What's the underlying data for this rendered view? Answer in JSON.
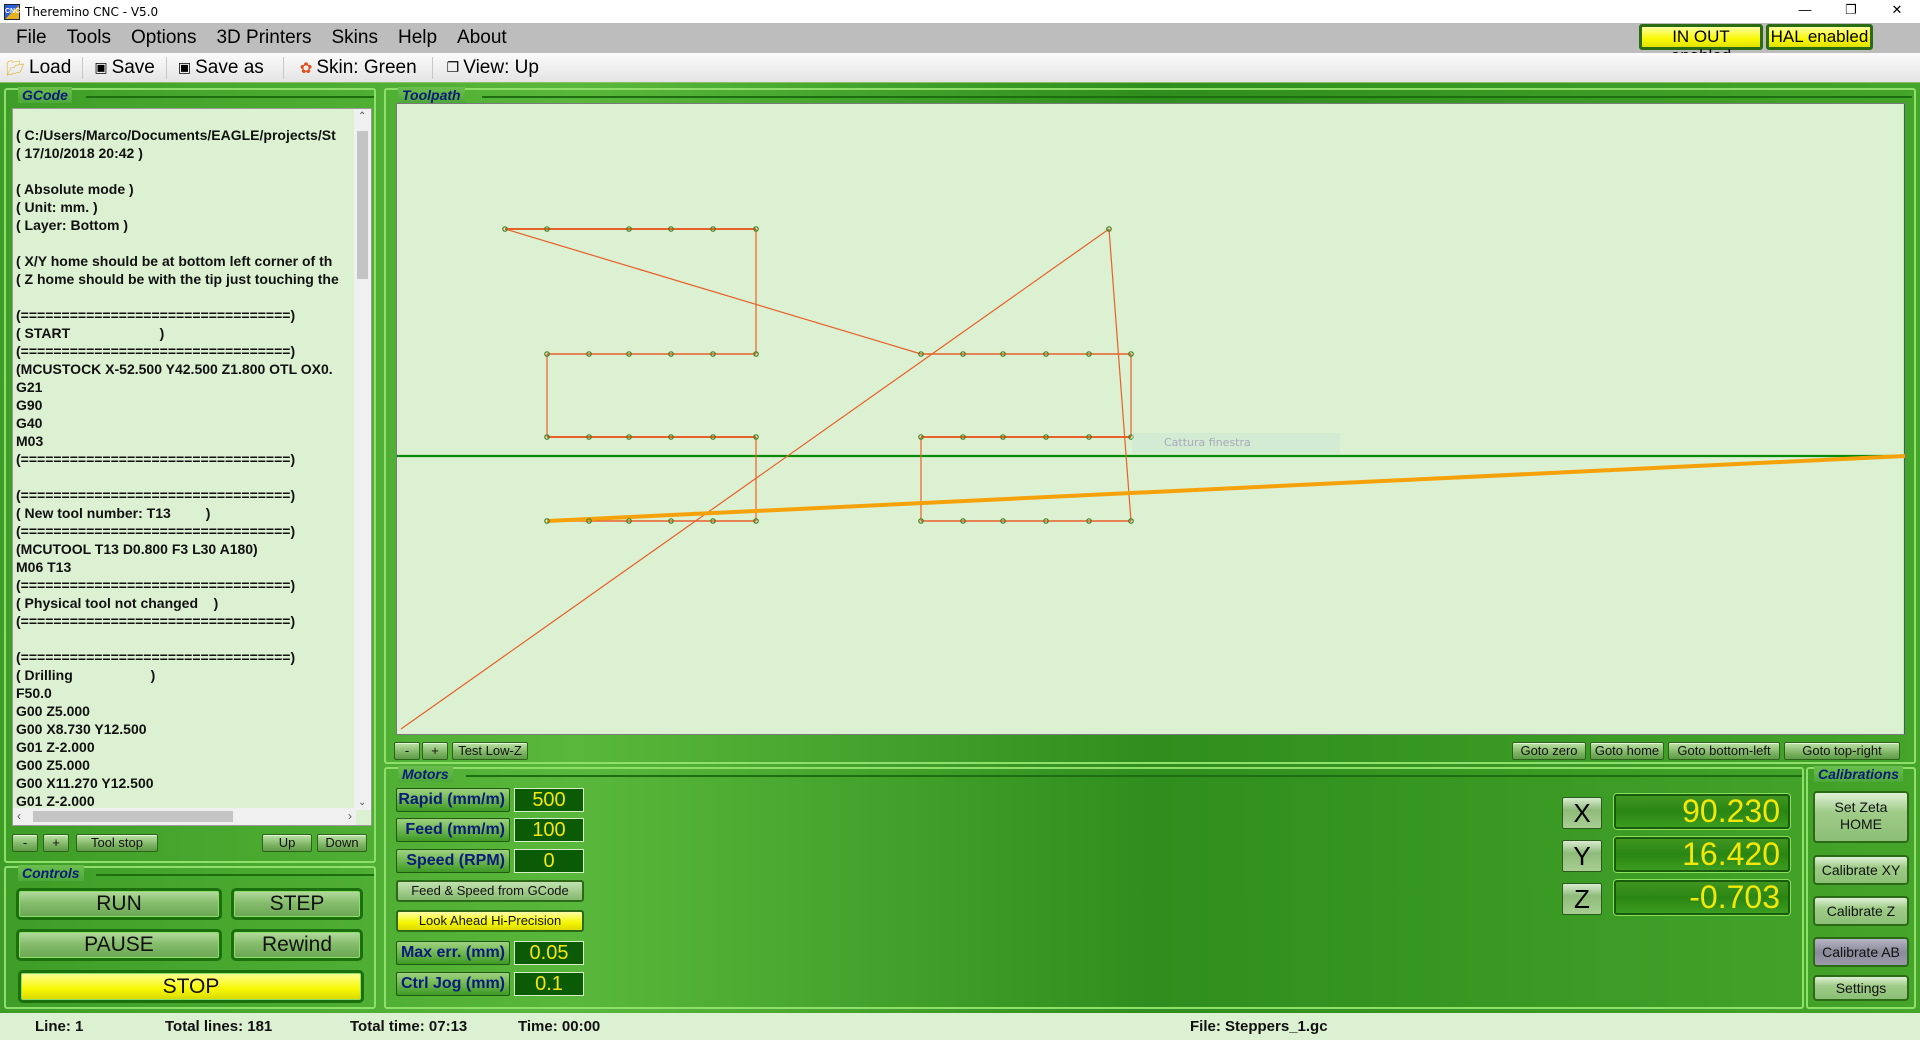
{
  "window": {
    "title": "Theremino CNC - V5.0",
    "app_icon_text": "CNC",
    "controls": {
      "minimize": "—",
      "restore": "❐",
      "close": "✕"
    }
  },
  "menu": [
    "File",
    "Tools",
    "Options",
    "3D Printers",
    "Skins",
    "Help",
    "About"
  ],
  "badges": {
    "in_out": "IN OUT enabled",
    "hal": "HAL enabled"
  },
  "toolbar": {
    "load": "Load",
    "load_icon": "folder-open-icon",
    "save": "Save",
    "save_icon": "floppy-icon",
    "save_as": "Save as",
    "save_as_icon": "floppy-icon",
    "skin": "Skin: Green",
    "skin_icon": "color-wheel-icon",
    "view": "View: Up",
    "view_icon": "cube-icon"
  },
  "gcode": {
    "title": "GCode",
    "lines": [
      "( C:/Users/Marco/Documents/EAGLE/projects/St",
      "( 17/10/2018 20:42 )",
      "",
      "( Absolute mode )",
      "( Unit: mm. )",
      "( Layer: Bottom )",
      "",
      "( X/Y home should be at bottom left corner of th",
      "( Z home should be with the tip just touching the",
      "",
      "(=================================)",
      "( START                       )",
      "(=================================)",
      "(MCUSTOCK X-52.500 Y42.500 Z1.800 OTL OX0.",
      "G21",
      "G90",
      "G40",
      "M03",
      "(=================================)",
      "",
      "(=================================)",
      "( New tool number: T13         )",
      "(=================================)",
      "(MCUTOOL T13 D0.800 F3 L30 A180)",
      "M06 T13",
      "(=================================)",
      "( Physical tool not changed    )",
      "(=================================)",
      "",
      "(=================================)",
      "( Drilling                    )",
      "F50.0",
      "G00 Z5.000",
      "G00 X8.730 Y12.500",
      "G01 Z-2.000",
      "G00 Z5.000",
      "G00 X11.270 Y12.500",
      "G01 Z-2.000"
    ],
    "buttons": {
      "minus": "-",
      "plus": "+",
      "tool_stop": "Tool stop",
      "up": "Up",
      "down": "Down"
    }
  },
  "controls": {
    "title": "Controls",
    "run": "RUN",
    "step": "STEP",
    "pause": "PAUSE",
    "rewind": "Rewind",
    "stop": "STOP"
  },
  "toolpath": {
    "title": "Toolpath",
    "buttons": {
      "minus": "-",
      "plus": "+",
      "test_low_z": "Test Low-Z",
      "goto_zero": "Goto zero",
      "goto_home": "Goto home",
      "goto_bottom_left": "Goto bottom-left",
      "goto_top_right": "Goto top-right"
    },
    "overlay_text": "Cattura finestra",
    "colors": {
      "path": "#e8602a",
      "rapid": "#f5a20a",
      "crosshair": "#0a8a0a",
      "point": "#3f7f1f"
    }
  },
  "motors": {
    "title": "Motors",
    "fields": [
      {
        "label": "Rapid (mm/m)",
        "value": "500"
      },
      {
        "label": "Feed (mm/m)",
        "value": "100"
      },
      {
        "label": "Speed (RPM)",
        "value": "0"
      }
    ],
    "feed_speed_button": "Feed & Speed from GCode",
    "look_ahead_button": "Look Ahead Hi-Precision",
    "fields2": [
      {
        "label": "Max err. (mm)",
        "value": "0.05"
      },
      {
        "label": "Ctrl Jog (mm)",
        "value": "0.1"
      }
    ]
  },
  "axes": [
    {
      "name": "X",
      "value": "90.230"
    },
    {
      "name": "Y",
      "value": "16.420"
    },
    {
      "name": "Z",
      "value": "-0.703"
    }
  ],
  "calibrations": {
    "title": "Calibrations",
    "set_zeta_home_line1": "Set Zeta",
    "set_zeta_home_line2": "HOME",
    "calibrate_xy": "Calibrate XY",
    "calibrate_z": "Calibrate Z",
    "calibrate_ab": "Calibrate AB",
    "settings": "Settings"
  },
  "status": {
    "line": "Line: 1",
    "total_lines": "Total lines: 181",
    "total_time": "Total time: 07:13",
    "time": "Time: 00:00",
    "file": "File: Steppers_1.gc"
  }
}
